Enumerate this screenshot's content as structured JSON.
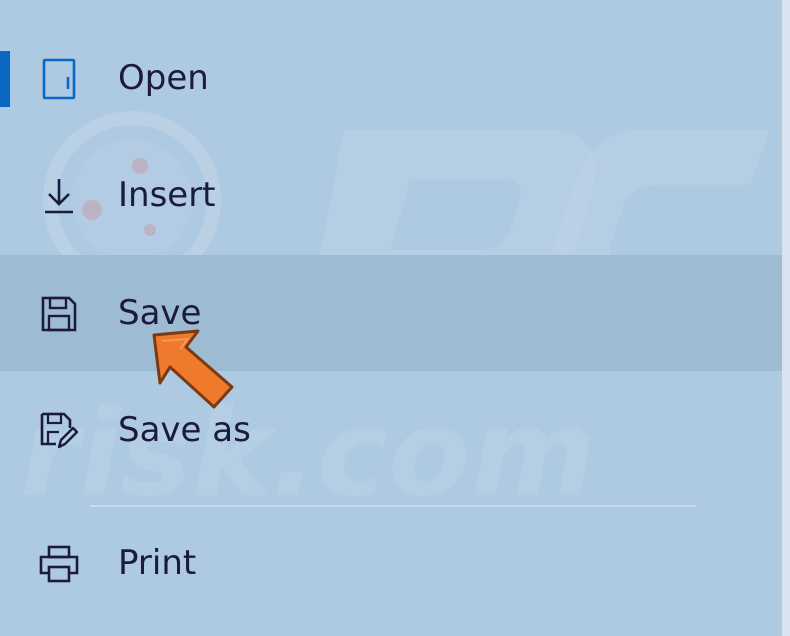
{
  "menu": {
    "items": [
      {
        "id": "open",
        "label": "Open",
        "icon": "open-file-icon"
      },
      {
        "id": "insert",
        "label": "Insert",
        "icon": "insert-download-icon"
      },
      {
        "id": "save",
        "label": "Save",
        "icon": "floppy-disk-icon"
      },
      {
        "id": "saveas",
        "label": "Save as",
        "icon": "save-as-icon"
      },
      {
        "id": "print",
        "label": "Print",
        "icon": "printer-icon"
      }
    ]
  },
  "colors": {
    "panel_background": "#aecae2",
    "highlight_background": "#9ebbd4",
    "accent": "#0b67c4",
    "text": "#1c1b3e",
    "arrow": "#f07a2c"
  }
}
